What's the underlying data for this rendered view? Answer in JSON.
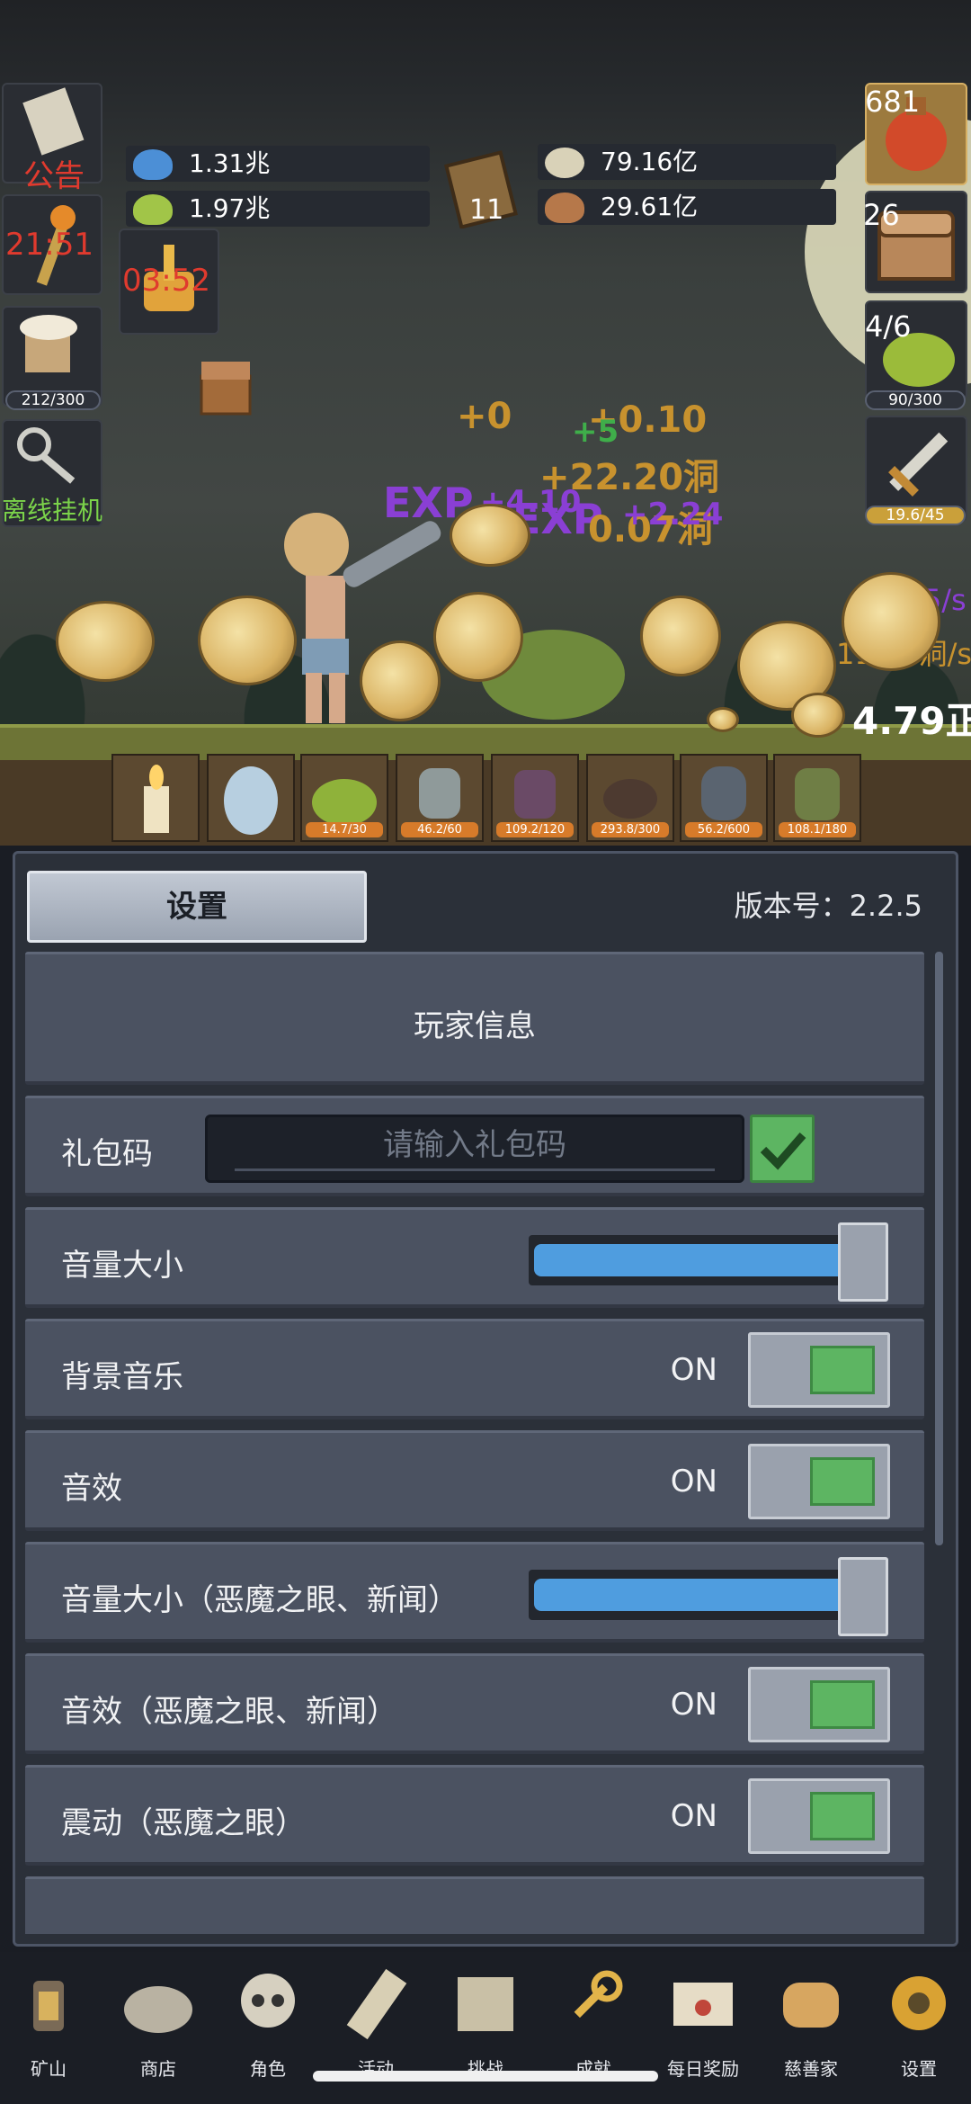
{
  "hud": {
    "notice_label": "公告",
    "torch_timer": "21:51",
    "chest_timer": "03:52",
    "bag_counter": "212/300",
    "offline_label": "离线挂机",
    "res_blue": "1.31兆",
    "res_green": "1.97兆",
    "book_count": "11",
    "res_coin": "79.16亿",
    "res_meat": "29.61亿",
    "potion_count": "681",
    "chest_count": "26",
    "slime_ratio": "4/6",
    "slime_bar": "90/300",
    "sword_bar": "19.6/45"
  },
  "battle": {
    "fx_1": "+0",
    "fx_2": "+0.10",
    "fx_3": "+5",
    "fx_4": "+22.20洞",
    "fx_5": "EXP",
    "fx_6": "+4.10",
    "fx_7": "EXP",
    "fx_8": "0.07洞",
    "fx_9": "+2.24",
    "rate_1": "9.35/s",
    "rate_2": "11.85洞/s",
    "total": "4.79正"
  },
  "monster_slots": [
    "14.7/30",
    "46.2/60",
    "109.2/120",
    "293.8/300",
    "56.2/600",
    "108.1/180"
  ],
  "settings": {
    "tab_label": "设置",
    "version": "版本号：2.2.5",
    "player_info": "玩家信息",
    "gift_label": "礼包码",
    "gift_placeholder": "请输入礼包码",
    "volume_label": "音量大小",
    "bgm_label": "背景音乐",
    "bgm_state": "ON",
    "sfx_label": "音效",
    "sfx_state": "ON",
    "volume2_label": "音量大小（恶魔之眼、新闻）",
    "sfx2_label": "音效（恶魔之眼、新闻）",
    "sfx2_state": "ON",
    "vibrate_label": "震动（恶魔之眼）",
    "vibrate_state": "ON",
    "volume_level": 1.0,
    "volume2_level": 1.0
  },
  "nav": [
    "矿山",
    "商店",
    "角色",
    "活动",
    "挑战",
    "成就",
    "每日奖励",
    "慈善家",
    "设置"
  ],
  "colors": {
    "accent_green": "#5db562",
    "slider_blue": "#4f9ddf",
    "panel_bg": "#2b3039",
    "row_bg": "#4b5261"
  }
}
